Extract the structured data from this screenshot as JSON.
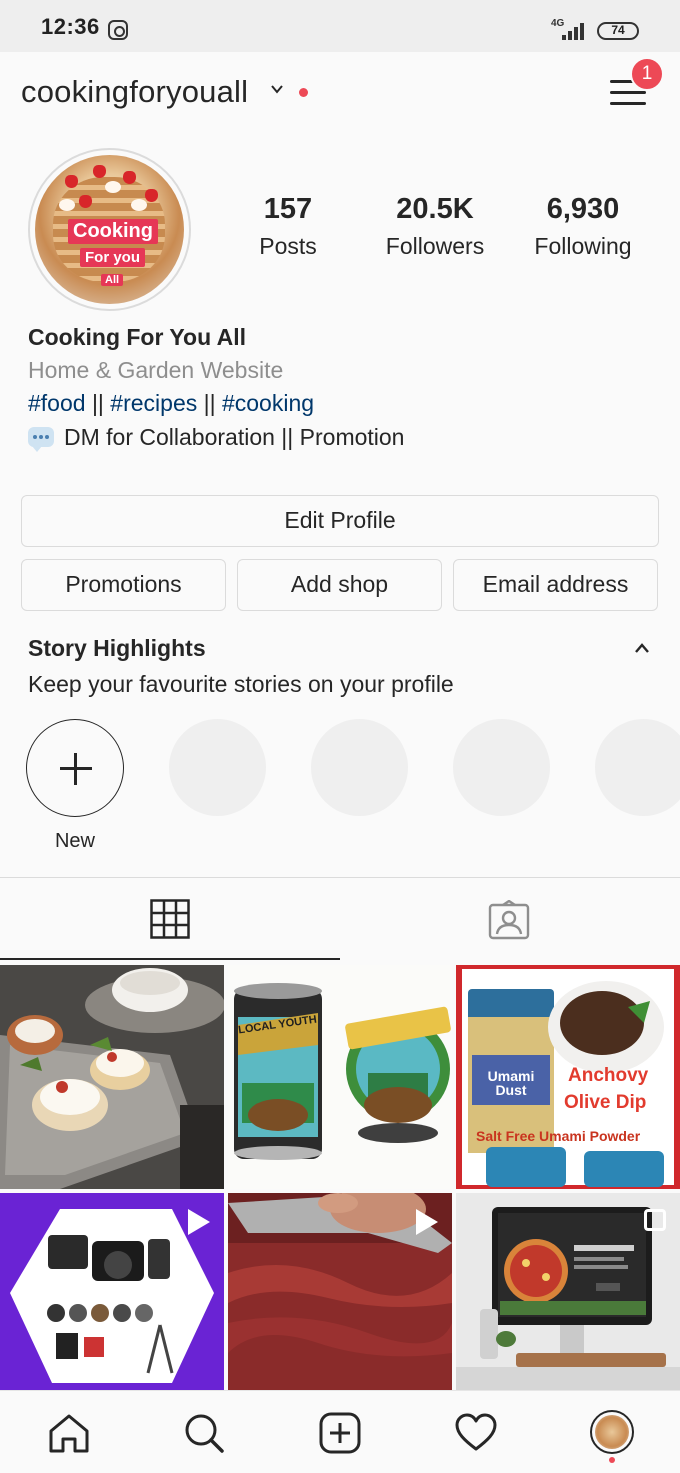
{
  "status_bar": {
    "time": "12:36",
    "network": "4G",
    "battery": "74"
  },
  "header": {
    "username": "cookingforyouall",
    "notification_count": "1"
  },
  "profile": {
    "avatar_text": [
      "Cooking",
      "For you",
      "All"
    ],
    "stats": [
      {
        "value": "157",
        "label": "Posts"
      },
      {
        "value": "20.5K",
        "label": "Followers"
      },
      {
        "value": "6,930",
        "label": "Following"
      }
    ],
    "name": "Cooking For You All",
    "category": "Home & Garden Website",
    "tags": [
      "#food",
      "#recipes",
      "#cooking"
    ],
    "tag_separator": " || ",
    "dm_line": "DM for Collaboration || Promotion"
  },
  "buttons": {
    "edit_profile": "Edit Profile",
    "promotions": "Promotions",
    "add_shop": "Add shop",
    "email_address": "Email address"
  },
  "highlights": {
    "title": "Story Highlights",
    "subtitle": "Keep your favourite stories on your profile",
    "new_label": "New"
  },
  "posts": {
    "post3_lines": [
      "Anchovy",
      "Olive Dip",
      "Salt Free Umami Powder"
    ],
    "post2_label": "LOCAL YOUTH",
    "post3_jar_label": "Umami Dust"
  },
  "colors": {
    "accent_red": "#ed4956",
    "link_blue": "#00376b",
    "secondary_text": "#8e8e8e",
    "border": "#dbdbdb"
  },
  "icons": [
    "instagram-status-icon",
    "chevron-down-icon",
    "menu-icon",
    "chevron-up-icon",
    "grid-icon",
    "tagged-icon",
    "home-icon",
    "search-icon",
    "new-post-icon",
    "heart-icon"
  ]
}
